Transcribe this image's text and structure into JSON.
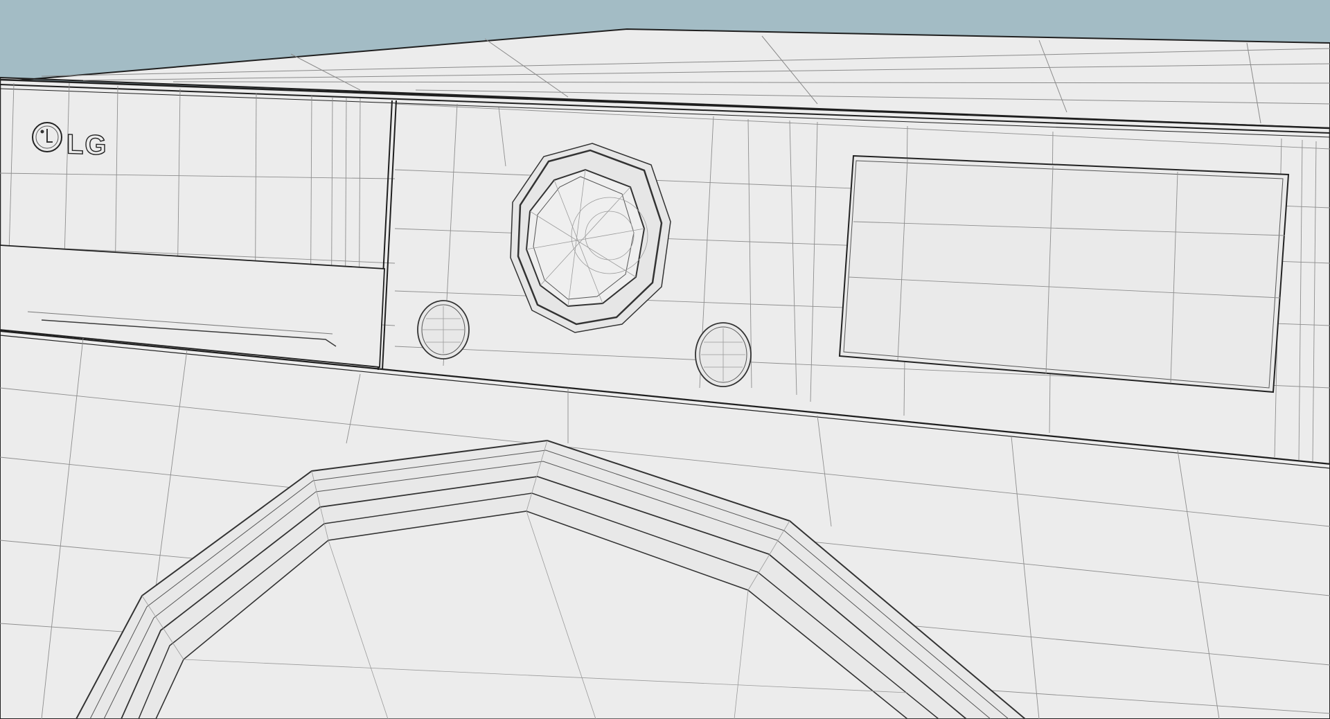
{
  "scene": {
    "kind": "wireframe-render",
    "subject": "washing-machine-control-panel",
    "colors": {
      "sky": "#a3bcc5",
      "surface": "#ececec",
      "wire": "#7a7a7a",
      "edge": "#1f1f1f"
    }
  },
  "branding": {
    "logo_text": "LG",
    "logo_icon": "lg-face-logo-icon"
  },
  "controls": {
    "main_dial_icon": "rotary-dial-icon",
    "left_button_icon": "round-button-icon",
    "right_button_icon": "round-button-icon",
    "display_icon": "display-panel-icon",
    "drawer_icon": "detergent-drawer-icon",
    "door_icon": "door-rim-icon"
  }
}
